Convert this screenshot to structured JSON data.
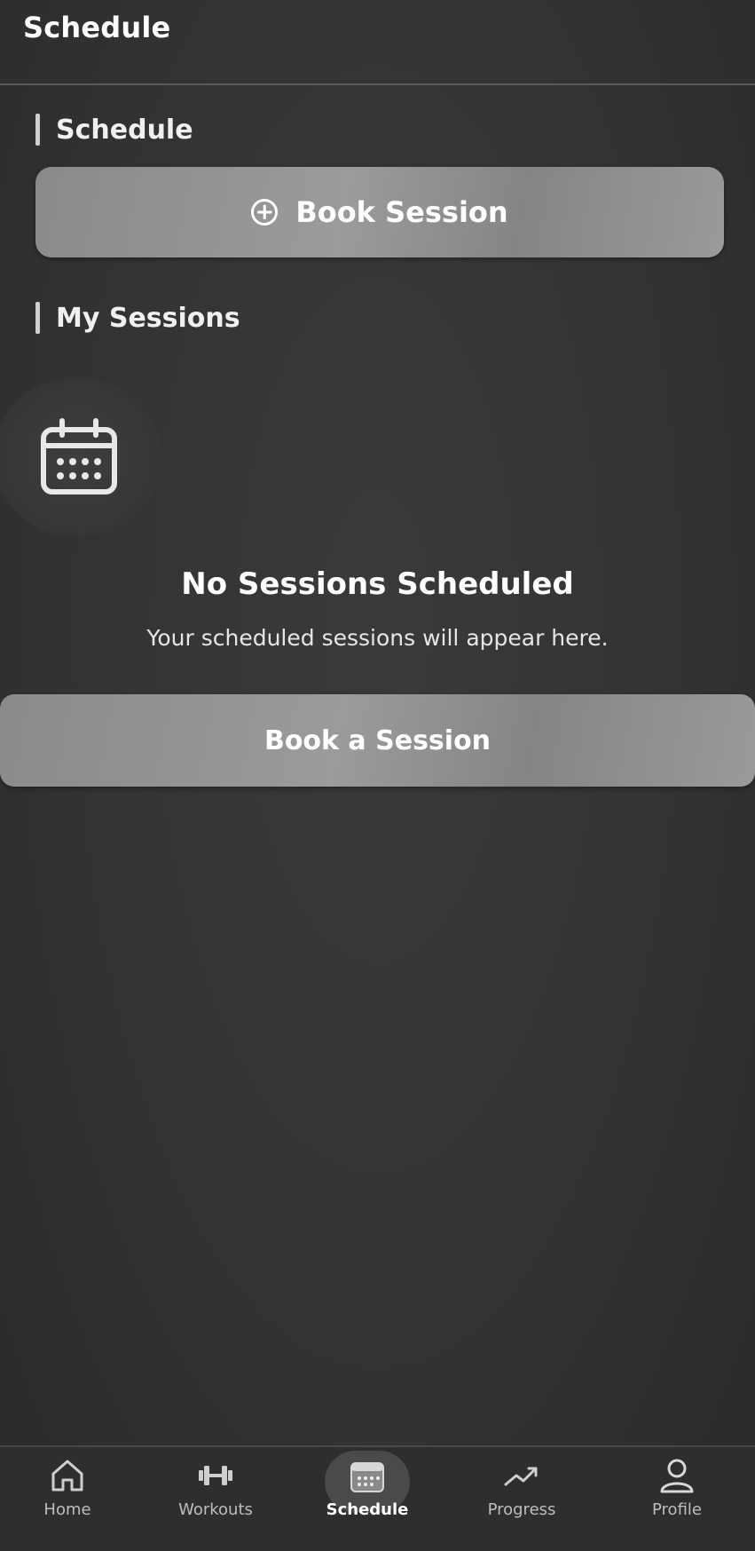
{
  "header": {
    "title": "Schedule"
  },
  "sections": {
    "schedule_title": "Schedule",
    "sessions_title": "My Sessions"
  },
  "actions": {
    "book_session_label": "Book Session",
    "book_a_session_label": "Book a Session"
  },
  "empty_state": {
    "icon": "calendar-icon",
    "title": "No Sessions Scheduled",
    "subtitle": "Your scheduled sessions will appear here."
  },
  "nav": {
    "items": [
      {
        "label": "Home",
        "icon": "home-icon"
      },
      {
        "label": "Workouts",
        "icon": "dumbbell-icon"
      },
      {
        "label": "Schedule",
        "icon": "calendar-icon"
      },
      {
        "label": "Progress",
        "icon": "trend-up-icon"
      },
      {
        "label": "Profile",
        "icon": "user-icon"
      }
    ],
    "active": "Schedule"
  },
  "colors": {
    "background": "#333333",
    "button": "#929292",
    "text": "#ffffff"
  }
}
